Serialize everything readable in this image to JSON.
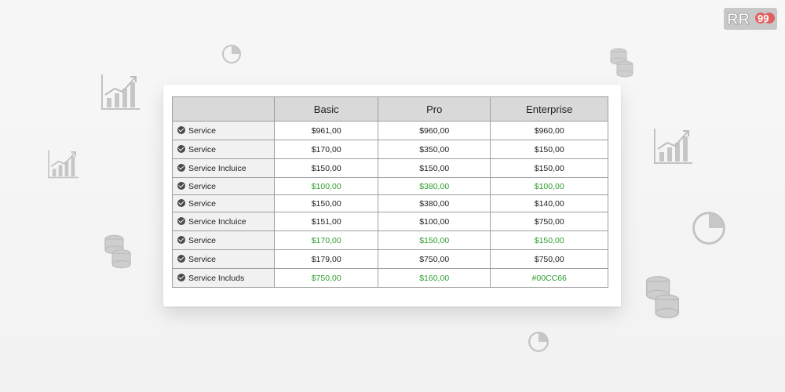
{
  "table": {
    "headers": [
      "",
      "Basic",
      "Pro",
      "Enterprise"
    ],
    "rows": [
      {
        "service": "Service",
        "basic": "$961,00",
        "pro": "$960,00",
        "enterprise": "$960,00",
        "highlight": false
      },
      {
        "service": "Service",
        "basic": "$170,00",
        "pro": "$350,00",
        "enterprise": "$150,00",
        "highlight": false
      },
      {
        "service": "Service Incluice",
        "basic": "$150,00",
        "pro": "$150,00",
        "enterprise": "$150,00",
        "highlight": false
      },
      {
        "service": "Service",
        "basic": "$100,00",
        "pro": "$380,00",
        "enterprise": "$100,00",
        "highlight": true
      },
      {
        "service": "Service",
        "basic": "$150,00",
        "pro": "$380,00",
        "enterprise": "$140,00",
        "highlight": false
      },
      {
        "service": "Service Incluice",
        "basic": "$151,00",
        "pro": "$100,00",
        "enterprise": "$750,00",
        "highlight": false
      },
      {
        "service": "Service",
        "basic": "$170,00",
        "pro": "$150,00",
        "enterprise": "$150,00",
        "highlight": true
      },
      {
        "service": "Service",
        "basic": "$179,00",
        "pro": "$750,00",
        "enterprise": "$750,00",
        "highlight": false
      },
      {
        "service": "Service Includs",
        "basic": "$750,00",
        "pro": "$160,00",
        "enterprise": "#00CC66",
        "highlight": true
      }
    ]
  },
  "logo": {
    "text": "RR99"
  },
  "icons": [
    "bar-chart-icon",
    "pie-chart-icon",
    "coin-stack-icon"
  ],
  "colors": {
    "highlight": "#2f9e2f",
    "header_bg": "#d9d9d9",
    "service_bg": "#f1f1f1",
    "grid": "#9e9e9e"
  }
}
